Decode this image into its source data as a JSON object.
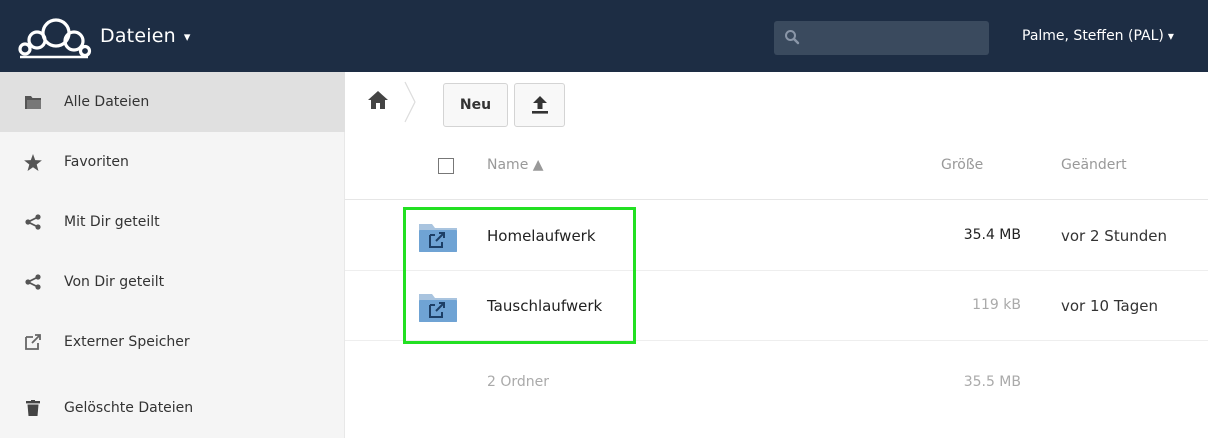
{
  "header": {
    "app_name": "Dateien",
    "app_caret": "▾",
    "search_placeholder": "",
    "user_name": "Palme, Steffen (PAL)",
    "user_caret": "▾",
    "background_color": "#1d2d44"
  },
  "sidebar": {
    "items": [
      {
        "label": "Alle Dateien",
        "icon": "folder-icon",
        "active": true
      },
      {
        "label": "Favoriten",
        "icon": "star-icon"
      },
      {
        "label": "Mit Dir geteilt",
        "icon": "share-icon"
      },
      {
        "label": "Von Dir geteilt",
        "icon": "share-icon"
      },
      {
        "label": "Externer Speicher",
        "icon": "external-link-icon"
      },
      {
        "label": "Gelöschte Dateien",
        "icon": "trash-icon"
      }
    ]
  },
  "controls": {
    "new_label": "Neu",
    "upload_icon": "upload-icon",
    "home_icon": "home-icon"
  },
  "list": {
    "columns": {
      "name": "Name ▲",
      "size": "Größe",
      "modified": "Geändert"
    },
    "rows": [
      {
        "name": "Homelaufwerk",
        "size": "35.4 MB",
        "modified": "vor 2 Stunden",
        "size_color": "#222222"
      },
      {
        "name": "Tauschlaufwerk",
        "size": "119 kB",
        "modified": "vor 10 Tagen",
        "size_color": "#aaaaaa"
      }
    ],
    "summary": {
      "label": "2 Ordner",
      "size": "35.5 MB"
    }
  },
  "colors": {
    "highlight": "#22e022",
    "accent_folder": "#6fa3d4"
  }
}
